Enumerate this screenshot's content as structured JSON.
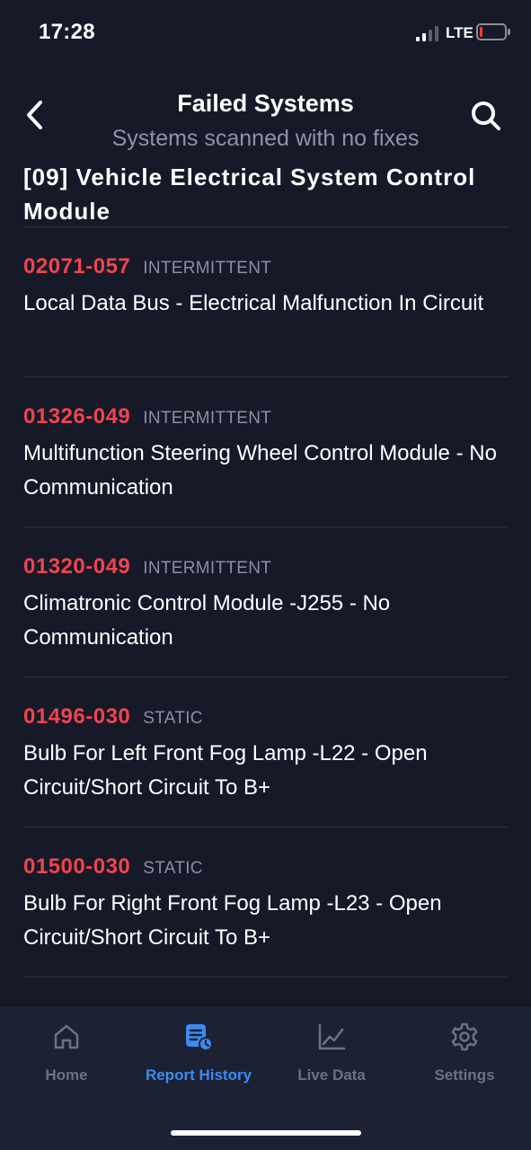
{
  "status_bar": {
    "time": "17:28",
    "network": "LTE",
    "signal_bars_active": 2,
    "signal_bars_total": 4,
    "battery_level": 0.1,
    "battery_color": "#ff3b30"
  },
  "header": {
    "title": "Failed Systems",
    "subtitle": "Systems scanned with no fixes",
    "back_icon": "chevron-left-icon",
    "search_icon": "search-icon"
  },
  "module": {
    "title": "[09] Vehicle Electrical System Control Module"
  },
  "faults": [
    {
      "code": "02071-057",
      "status": "INTERMITTENT",
      "description": "Local Data Bus - Electrical Malfunction In Circuit"
    },
    {
      "code": "01326-049",
      "status": "INTERMITTENT",
      "description": "Multifunction Steering Wheel Control Module - No Communication"
    },
    {
      "code": "01320-049",
      "status": "INTERMITTENT",
      "description": "Climatronic Control Module -J255 - No Communication"
    },
    {
      "code": "01496-030",
      "status": "STATIC",
      "description": "Bulb For Left Front Fog Lamp -L22 - Open Circuit/Short Circuit To B+"
    },
    {
      "code": "01500-030",
      "status": "STATIC",
      "description": "Bulb For Right Front Fog Lamp -L23 - Open Circuit/Short Circuit To B+"
    }
  ],
  "tabs": [
    {
      "label": "Home",
      "icon": "home-icon",
      "active": false
    },
    {
      "label": "Report History",
      "icon": "report-history-icon",
      "active": true
    },
    {
      "label": "Live Data",
      "icon": "chart-line-icon",
      "active": false
    },
    {
      "label": "Settings",
      "icon": "gear-icon",
      "active": false
    }
  ],
  "colors": {
    "background": "#161928",
    "tab_bar": "#1d2134",
    "fault_code": "#f0444e",
    "accent": "#3b8cf0",
    "muted": "#8b8fa3"
  }
}
